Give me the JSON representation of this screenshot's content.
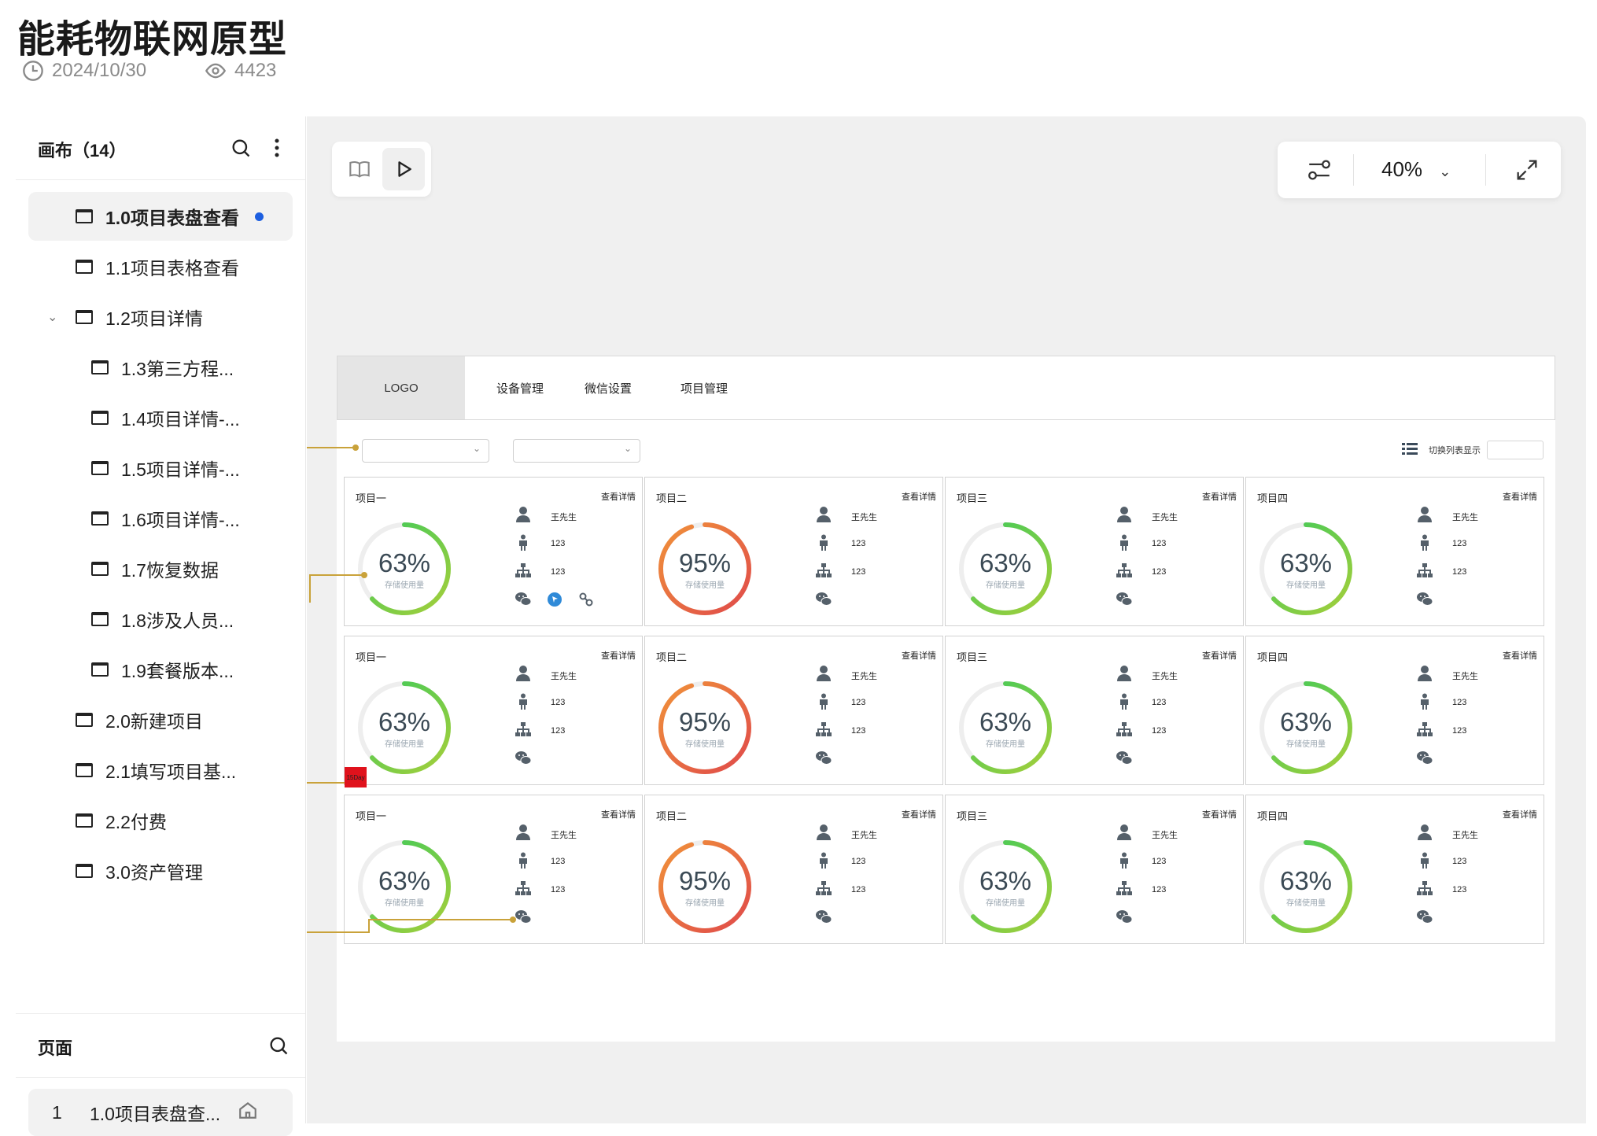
{
  "header": {
    "title": "能耗物联网原型",
    "date": "2024/10/30",
    "views": "4423"
  },
  "sidebar": {
    "canvas_title": "画布（14）",
    "items": [
      {
        "label": "1.0项目表盘查看",
        "active": true
      },
      {
        "label": "1.1项目表格查看"
      },
      {
        "label": "1.2项目详情",
        "expanded": true
      },
      {
        "label": "1.3第三方程..."
      },
      {
        "label": "1.4项目详情-..."
      },
      {
        "label": "1.5项目详情-..."
      },
      {
        "label": "1.6项目详情-..."
      },
      {
        "label": "1.7恢复数据"
      },
      {
        "label": "1.8涉及人员..."
      },
      {
        "label": "1.9套餐版本..."
      },
      {
        "label": "2.0新建项目"
      },
      {
        "label": "2.1填写项目基..."
      },
      {
        "label": "2.2付费"
      },
      {
        "label": "3.0资产管理"
      }
    ],
    "pages_title": "页面",
    "page_item": {
      "index": "1",
      "label": "1.0项目表盘查..."
    }
  },
  "toolbar": {
    "zoom": "40%"
  },
  "prototype": {
    "logo": "LOGO",
    "nav": [
      "设备管理",
      "微信设置",
      "项目管理"
    ],
    "switch_label": "切换列表显示",
    "badge": "15Day",
    "detail_label": "查看详情",
    "ring_caption": "存储使用量",
    "contact_name": "王先生",
    "value_a": "123",
    "value_b": "123",
    "cards": [
      {
        "name": "项目一",
        "percent": "63%",
        "value": 0.63,
        "palette": "green"
      },
      {
        "name": "项目二",
        "percent": "95%",
        "value": 0.95,
        "palette": "orange"
      },
      {
        "name": "项目三",
        "percent": "63%",
        "value": 0.63,
        "palette": "green"
      },
      {
        "name": "项目四",
        "percent": "63%",
        "value": 0.63,
        "palette": "green"
      }
    ],
    "colors": {
      "green_start": "#38c95c",
      "green_end": "#a6cf3a",
      "orange_start": "#f0923a",
      "orange_end": "#e04a4a",
      "ring_track": "#eeeeee",
      "connector": "#c9a23a"
    }
  }
}
